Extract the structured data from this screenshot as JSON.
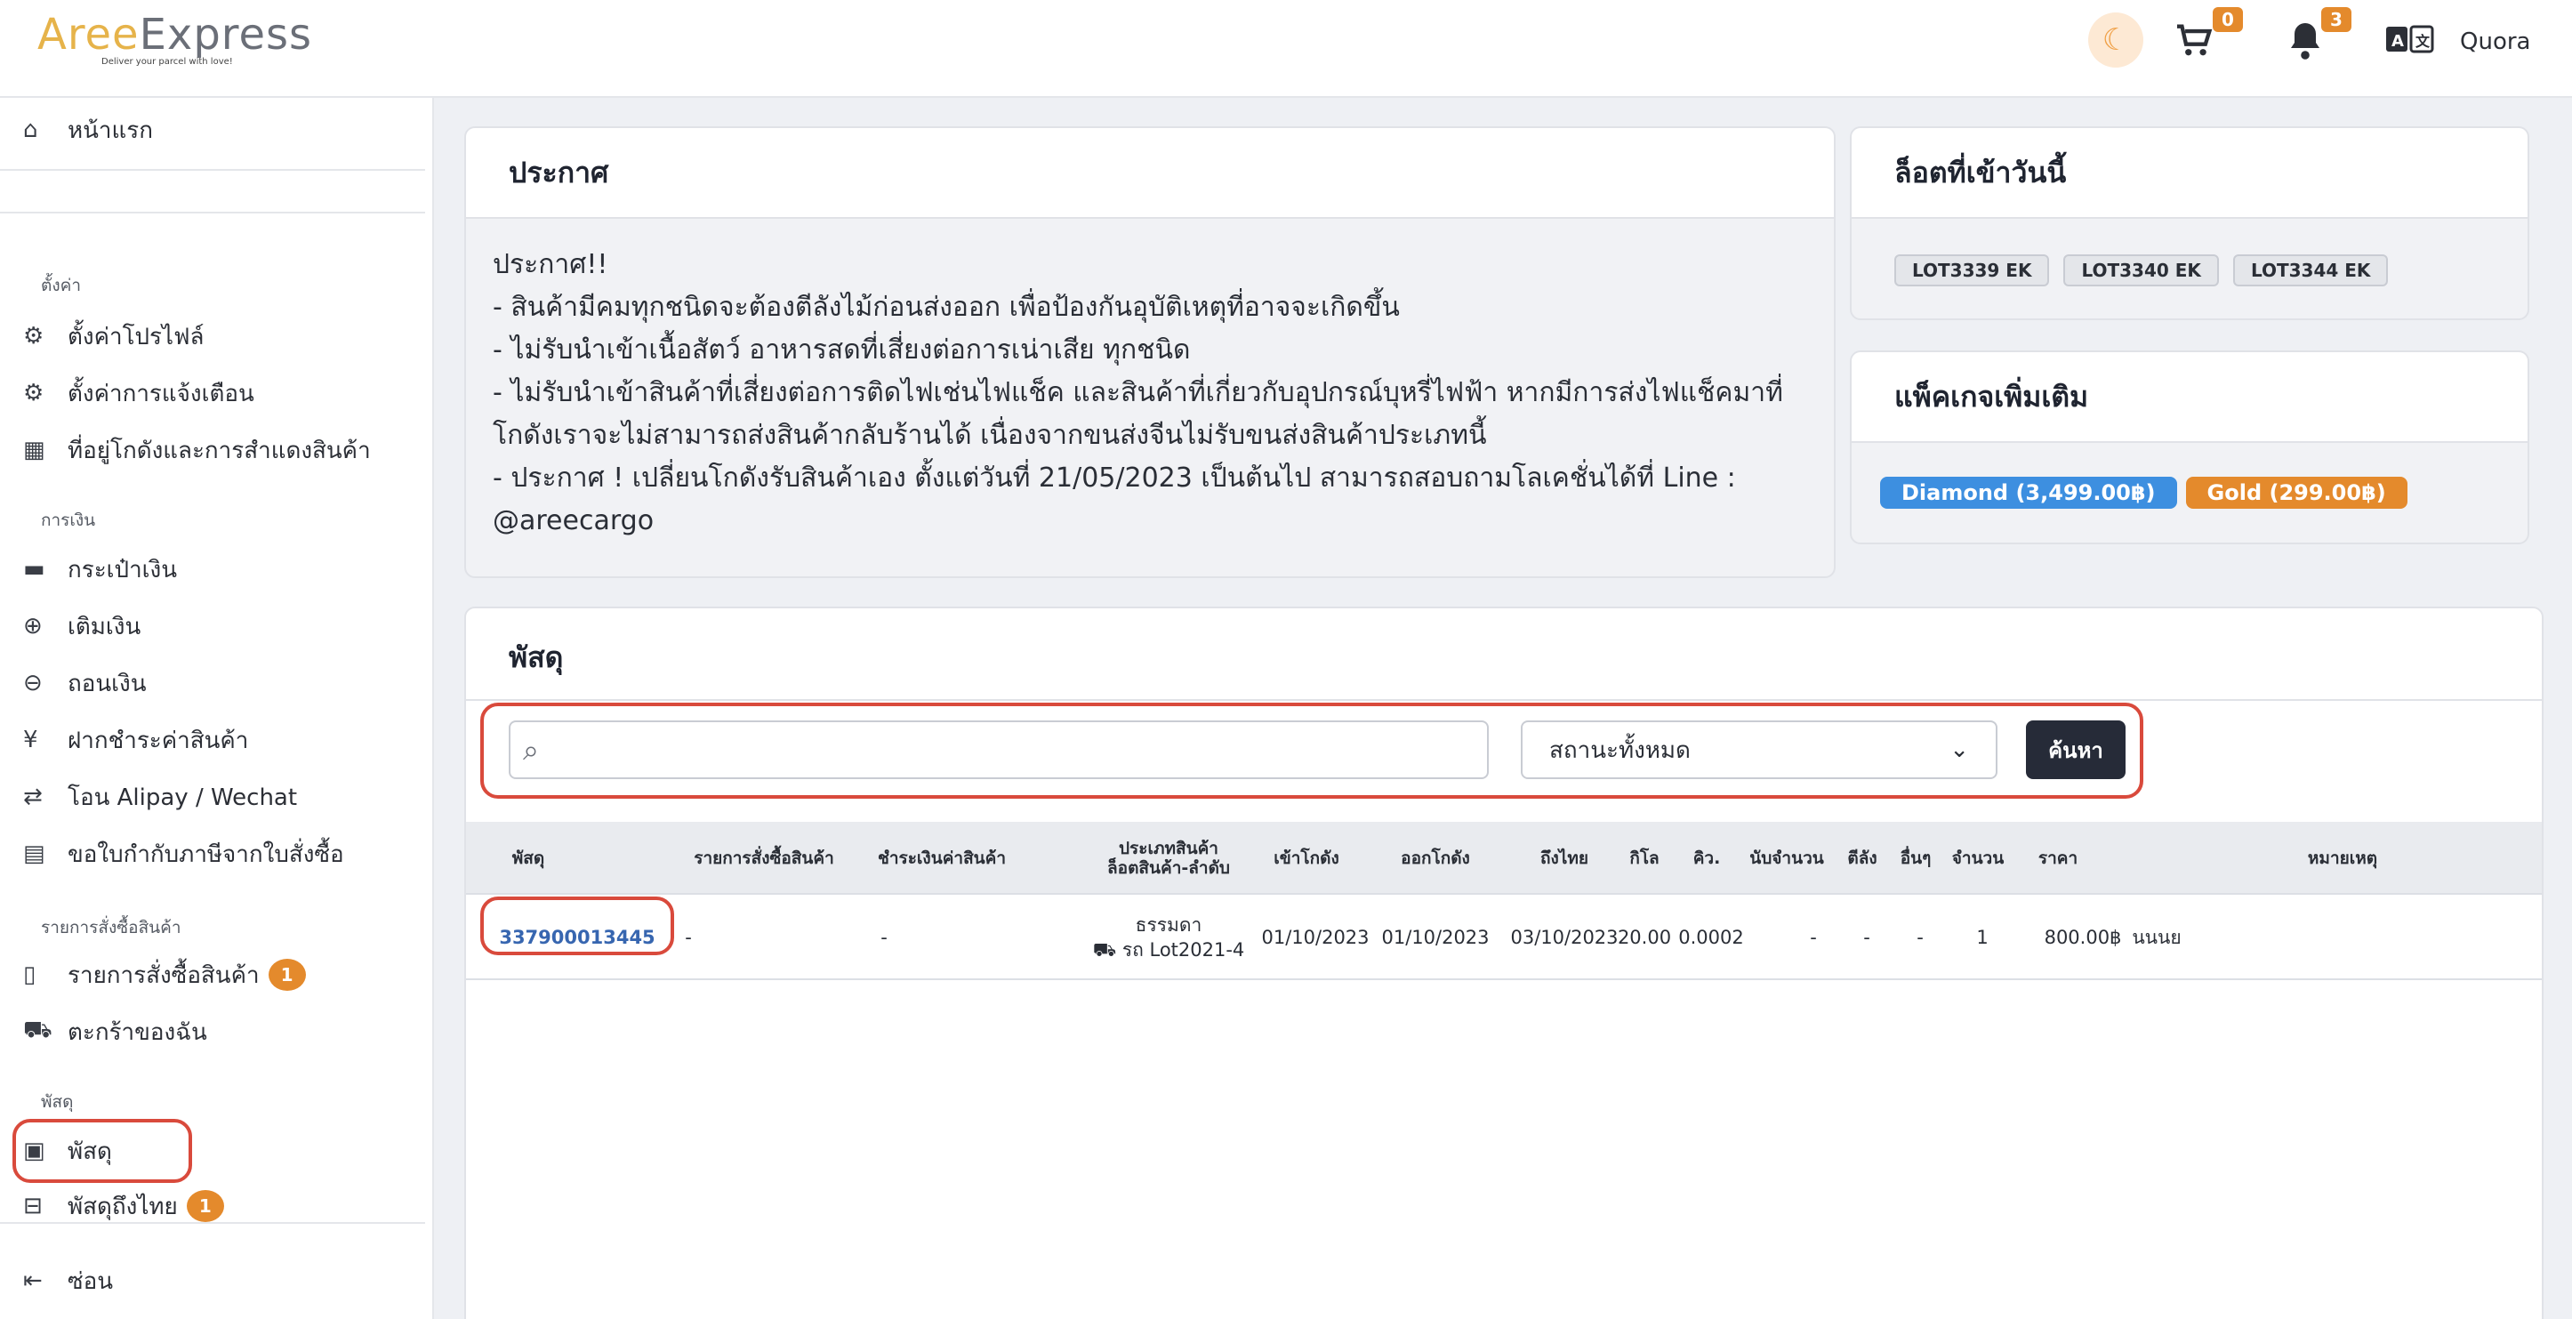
{
  "header": {
    "logo_prefix": "Aree",
    "logo_suffix": "Express",
    "logo_tagline": "Deliver your parcel with love!",
    "cart_count": "0",
    "notification_count": "3",
    "user_name": "Quora",
    "icons": [
      "moon-icon",
      "cart-icon",
      "bell-icon",
      "language-icon"
    ],
    "colors": {
      "badge": "#e48a2c",
      "accent": "#e6b34a"
    }
  },
  "sidebar": {
    "home": "หน้าแรก",
    "section_settings": "ตั้งค่า",
    "profile_settings": "ตั้งค่าโปรไฟล์",
    "notification_settings": "ตั้งค่าการแจ้งเตือน",
    "warehouse_address": "ที่อยู่โกดังและการสำแดงสินค้า",
    "section_finance": "การเงิน",
    "wallet": "กระเป๋าเงิน",
    "topup": "เติมเงิน",
    "withdraw": "ถอนเงิน",
    "pay_for_goods": "ฝากชำระค่าสินค้า",
    "transfer_alipay": "โอน Alipay / Wechat",
    "tax_invoice": "ขอใบกำกับภาษีจากใบสั่งซื้อ",
    "section_orders": "รายการสั่งซื้อสินค้า",
    "orders": "รายการสั่งซื้อสินค้า",
    "orders_badge": "1",
    "my_cart": "ตะกร้าของฉัน",
    "section_parcels": "พัสดุ",
    "parcels": "พัสดุ",
    "parcels_thailand": "พัสดุถึงไทย",
    "parcels_thailand_badge": "1",
    "collapse": "ซ่อน"
  },
  "announcement": {
    "title": "ประกาศ",
    "lines": [
      "ประกาศ!!",
      "- สินค้ามีคมทุกชนิดจะต้องตีลังไม้ก่อนส่งออก เพื่อป้องกันอุบัติเหตุที่อาจจะเกิดขึ้น",
      "- ไม่รับนำเข้าเนื้อสัตว์ อาหารสดที่เสี่ยงต่อการเน่าเสีย ทุกชนิด",
      "- ไม่รับนำเข้าสินค้าที่เสี่ยงต่อการติดไฟเช่นไฟแช็ค และสินค้าที่เกี่ยวกับอุปกรณ์บุหรี่ไฟฟ้า หากมีการส่งไฟแช็คมาที่",
      "โกดังเราจะไม่สามารถส่งสินค้ากลับร้านได้ เนื่องจากขนส่งจีนไม่รับขนส่งสินค้าประเภทนี้",
      "- ประกาศ ! เปลี่ยนโกดังรับสินค้าเอง ตั้งแต่วันที่ 21/05/2023 เป็นต้นไป สามารถสอบถามโลเคชั่นได้ที่ Line :",
      "@areecargo"
    ]
  },
  "lots_today": {
    "title": "ล็อตที่เข้าวันนี้",
    "lots": [
      "LOT3339 EK",
      "LOT3340 EK",
      "LOT3344 EK"
    ]
  },
  "packages": {
    "title": "แพ็คเกจเพิ่มเติม",
    "items": [
      {
        "label": "Diamond (3,499.00฿)",
        "color": "#3d8fe0"
      },
      {
        "label": "Gold (299.00฿)",
        "color": "#e48a2c"
      }
    ]
  },
  "parcels": {
    "title": "พัสดุ",
    "search_placeholder": "",
    "status_selected": "สถานะทั้งหมด",
    "search_button": "ค้นหา",
    "columns": [
      "พัสดุ",
      "รายการสั่งซื้อสินค้า",
      "ชำระเงินค่าสินค้า",
      "ประเภทสินค้า",
      "ล็อตสินค้า-ลำดับ",
      "เข้าโกดัง",
      "ออกโกดัง",
      "ถึงไทย",
      "กิโล",
      "คิว.",
      "นับจำนวน",
      "ตีลัง",
      "อื่นๆ",
      "จำนวน",
      "ราคา",
      "หมายเหตุ"
    ],
    "rows": [
      {
        "tracking": "337900013445",
        "order": "-",
        "payment": "-",
        "type": "ธรรมดา",
        "lot": "รถ Lot2021-4",
        "in_warehouse": "01/10/2023",
        "out_warehouse": "01/10/2023",
        "arrived_thailand": "03/10/2023",
        "kg": "20.00",
        "cbm": "0.0002",
        "count": "-",
        "crate": "-",
        "other": "-",
        "quantity": "1",
        "price": "800.00฿",
        "note": "นนนย"
      }
    ]
  }
}
